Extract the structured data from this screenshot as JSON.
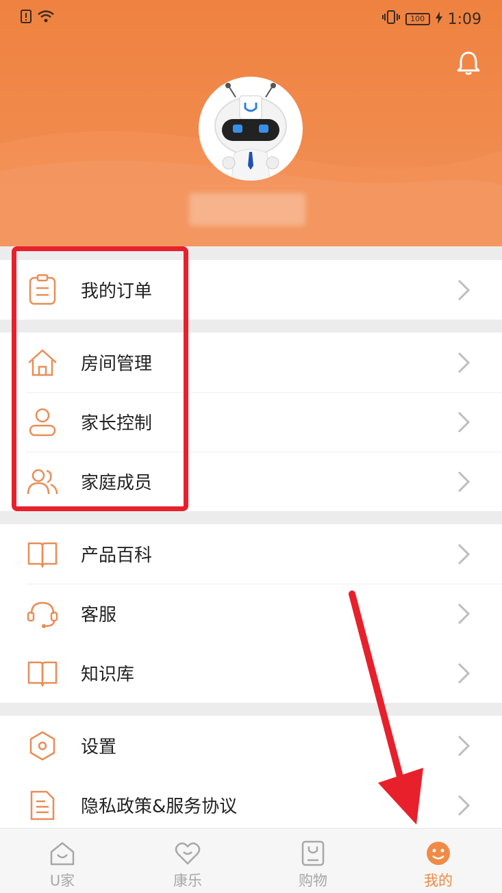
{
  "status_bar": {
    "time": "1:09",
    "battery": "100"
  },
  "menu": {
    "group1": [
      {
        "label": "我的订单",
        "icon": "clipboard-icon"
      }
    ],
    "group2": [
      {
        "label": "房间管理",
        "icon": "house-icon"
      },
      {
        "label": "家长控制",
        "icon": "user-icon"
      },
      {
        "label": "家庭成员",
        "icon": "users-icon"
      }
    ],
    "group3": [
      {
        "label": "产品百科",
        "icon": "book-icon"
      },
      {
        "label": "客服",
        "icon": "headset-icon"
      },
      {
        "label": "知识库",
        "icon": "book-icon"
      }
    ],
    "group4": [
      {
        "label": "设置",
        "icon": "hexagon-gear-icon"
      },
      {
        "label": "隐私政策&服务协议",
        "icon": "document-icon"
      }
    ]
  },
  "bottom_nav": [
    {
      "label": "U家",
      "icon": "home-u-icon",
      "active": false
    },
    {
      "label": "康乐",
      "icon": "heart-icon",
      "active": false
    },
    {
      "label": "购物",
      "icon": "shopping-bag-icon",
      "active": false
    },
    {
      "label": "我的",
      "icon": "smiley-icon",
      "active": true
    }
  ],
  "colors": {
    "accent": "#f08a45",
    "annotation": "#e8202b"
  }
}
